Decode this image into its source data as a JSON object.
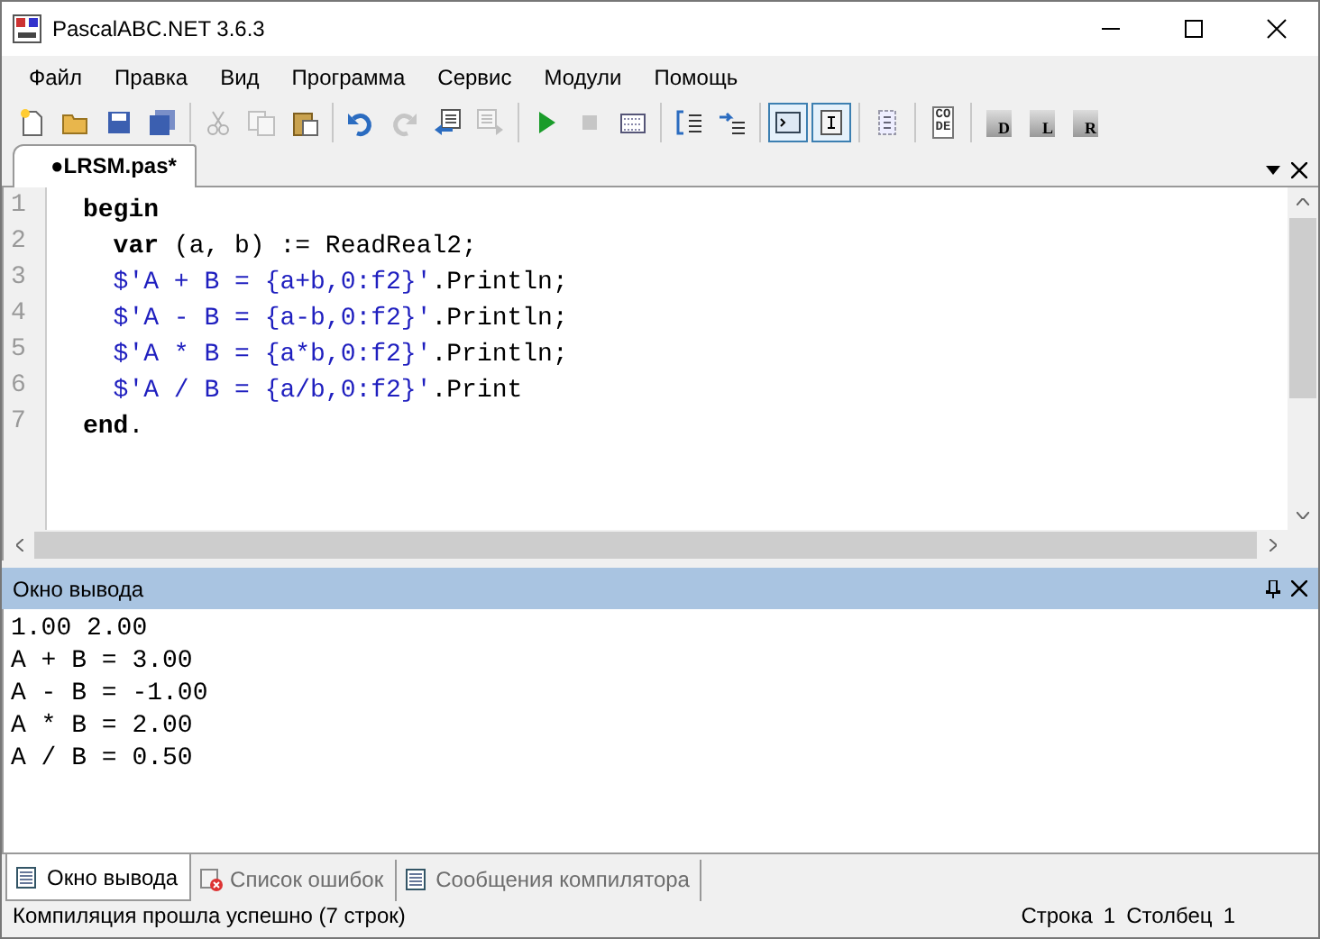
{
  "window": {
    "title": "PascalABC.NET 3.6.3"
  },
  "menu": [
    "Файл",
    "Правка",
    "Вид",
    "Программа",
    "Сервис",
    "Модули",
    "Помощь"
  ],
  "toolbar": [
    [
      {
        "kind": "new",
        "disabled": false,
        "selected": false
      },
      {
        "kind": "open",
        "disabled": false,
        "selected": false
      },
      {
        "kind": "save",
        "disabled": false,
        "selected": false
      },
      {
        "kind": "saveall",
        "disabled": false,
        "selected": false
      }
    ],
    [
      {
        "kind": "cut",
        "disabled": true,
        "selected": false
      },
      {
        "kind": "copy",
        "disabled": true,
        "selected": false
      },
      {
        "kind": "paste",
        "disabled": false,
        "selected": false
      }
    ],
    [
      {
        "kind": "undo",
        "disabled": false,
        "selected": false
      },
      {
        "kind": "redo",
        "disabled": true,
        "selected": false
      },
      {
        "kind": "back",
        "disabled": false,
        "selected": false
      },
      {
        "kind": "forward",
        "disabled": true,
        "selected": false
      }
    ],
    [
      {
        "kind": "run",
        "disabled": false,
        "selected": false
      },
      {
        "kind": "stop",
        "disabled": true,
        "selected": false
      },
      {
        "kind": "grid",
        "disabled": false,
        "selected": false
      }
    ],
    [
      {
        "kind": "stepin",
        "disabled": false,
        "selected": false
      },
      {
        "kind": "stepover",
        "disabled": false,
        "selected": false
      }
    ],
    [
      {
        "kind": "console",
        "disabled": false,
        "selected": true
      },
      {
        "kind": "cursor",
        "disabled": false,
        "selected": true
      }
    ],
    [
      {
        "kind": "list",
        "disabled": false,
        "selected": false
      }
    ],
    [
      {
        "kind": "letters",
        "text": "CODE",
        "disabled": false,
        "selected": false
      }
    ],
    [
      {
        "kind": "page",
        "text": "D",
        "disabled": false,
        "selected": false
      },
      {
        "kind": "page",
        "text": "L",
        "disabled": false,
        "selected": false
      },
      {
        "kind": "page",
        "text": "R",
        "disabled": false,
        "selected": false
      }
    ]
  ],
  "editor_tab": {
    "label": "●LRSM.pas*",
    "selected": true
  },
  "code": [
    {
      "number": "1",
      "tokens": [
        {
          "kind": "keyword",
          "text": "begin"
        }
      ]
    },
    {
      "number": "2",
      "tokens": [
        {
          "kind": "keyword",
          "text": "  var"
        },
        {
          "kind": "plain",
          "text": " (a, b) := ReadReal2;"
        }
      ]
    },
    {
      "number": "3",
      "tokens": [
        {
          "kind": "string",
          "text": "  $'A + B = {a+b,0:f2}'"
        },
        {
          "kind": "plain",
          "text": ".Println;"
        }
      ]
    },
    {
      "number": "4",
      "tokens": [
        {
          "kind": "string",
          "text": "  $'A - B = {a-b,0:f2}'"
        },
        {
          "kind": "plain",
          "text": ".Println;"
        }
      ]
    },
    {
      "number": "5",
      "tokens": [
        {
          "kind": "string",
          "text": "  $'A * B = {a*b,0:f2}'"
        },
        {
          "kind": "plain",
          "text": ".Println;"
        }
      ]
    },
    {
      "number": "6",
      "tokens": [
        {
          "kind": "string",
          "text": "  $'A / B = {a/b,0:f2}'"
        },
        {
          "kind": "plain",
          "text": ".Print"
        }
      ]
    },
    {
      "number": "7",
      "tokens": [
        {
          "kind": "keyword",
          "text": "end"
        },
        {
          "kind": "plain",
          "text": "."
        }
      ]
    }
  ],
  "output_panel": {
    "title": "Окно вывода",
    "lines": [
      "1.00 2.00",
      "A + B = 3.00",
      "A - B = -1.00",
      "A * B = 2.00",
      "A / B = 0.50"
    ]
  },
  "bottom_tabs": [
    {
      "label": "Окно вывода",
      "kind": "output",
      "selected": true
    },
    {
      "label": "Список ошибок",
      "kind": "errors",
      "selected": false
    },
    {
      "label": "Сообщения компилятора",
      "kind": "messages",
      "selected": false
    }
  ],
  "status_bar": {
    "message": "Компиляция прошла успешно (7 строк)",
    "line_label": "Строка",
    "line": "1",
    "column_label": "Столбец",
    "column": "1"
  }
}
